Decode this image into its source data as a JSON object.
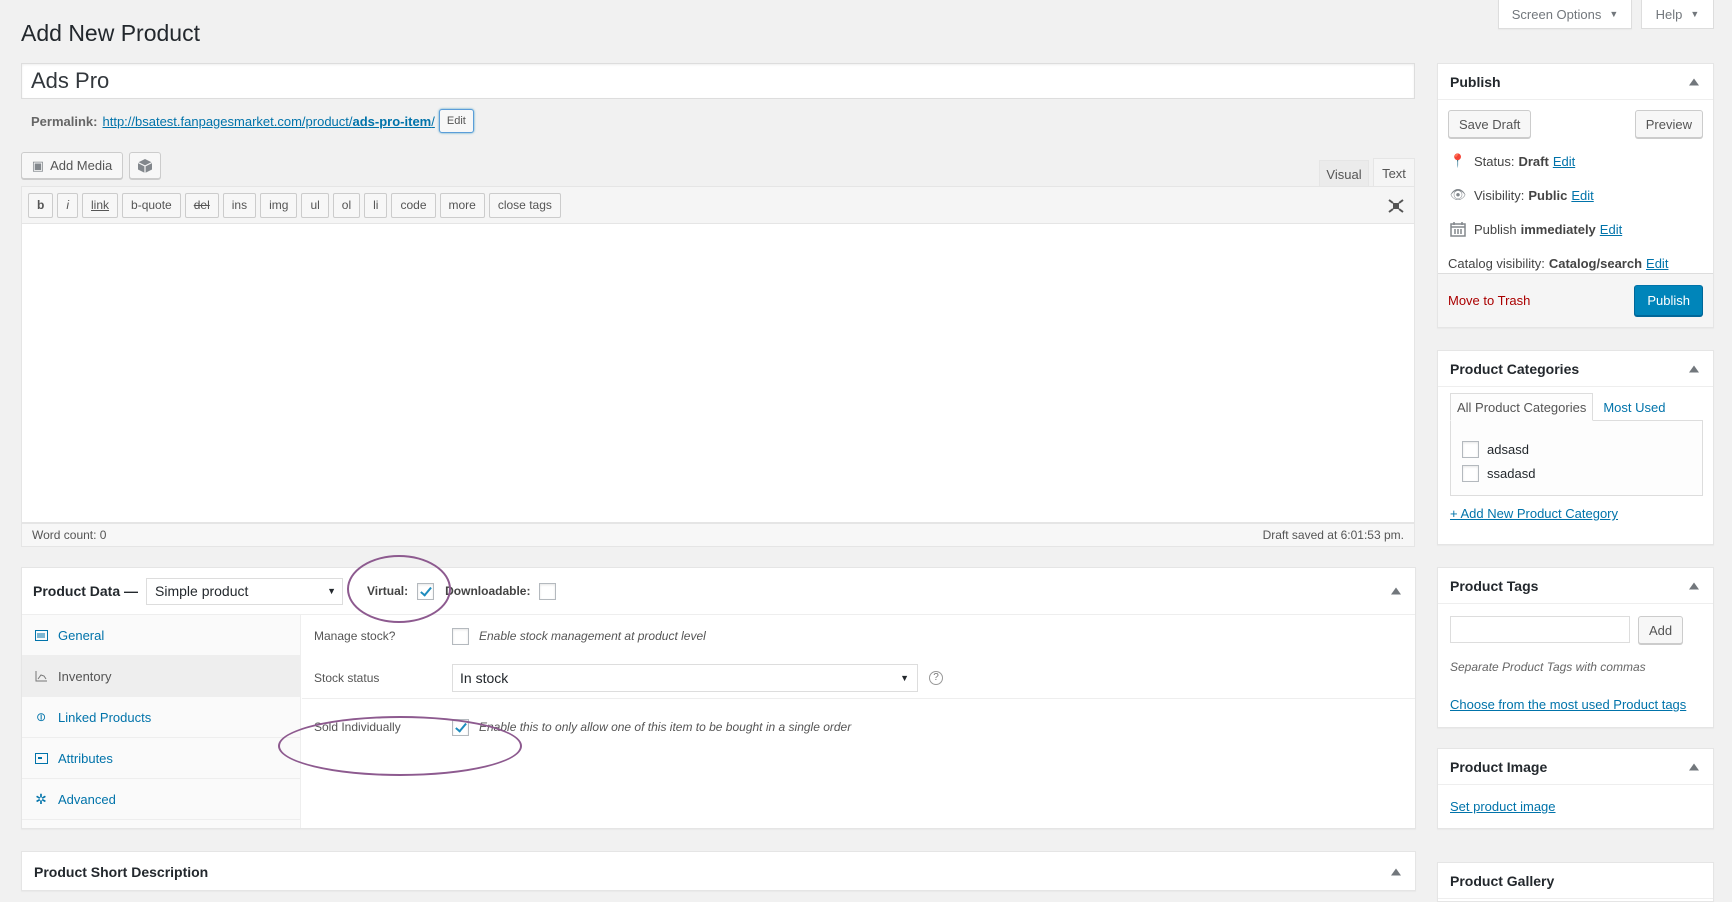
{
  "header": {
    "page_title": "Add New Product",
    "screen_options": "Screen Options",
    "help": "Help"
  },
  "title_input": {
    "value": "Ads Pro"
  },
  "permalink": {
    "label": "Permalink:",
    "url_base": "http://bsatest.fanpagesmarket.com/product/",
    "slug": "ads-pro-item",
    "trailing": "/",
    "edit_label": "Edit"
  },
  "editor": {
    "add_media": "Add Media",
    "tab_visual": "Visual",
    "tab_text": "Text",
    "quicktags": [
      "b",
      "i",
      "link",
      "b-quote",
      "del",
      "ins",
      "img",
      "ul",
      "ol",
      "li",
      "code",
      "more",
      "close tags"
    ],
    "content": "",
    "word_count": "Word count: 0",
    "draft_saved": "Draft saved at 6:01:53 pm."
  },
  "product_data": {
    "title": "Product Data —",
    "type_selected": "Simple product",
    "virtual_label": "Virtual:",
    "virtual_checked": true,
    "downloadable_label": "Downloadable:",
    "downloadable_checked": false,
    "tabs": [
      {
        "label": "General",
        "icon": "general-icon"
      },
      {
        "label": "Inventory",
        "icon": "inventory-icon",
        "active": true
      },
      {
        "label": "Linked Products",
        "icon": "link-icon"
      },
      {
        "label": "Attributes",
        "icon": "attributes-icon"
      },
      {
        "label": "Advanced",
        "icon": "gear-icon"
      }
    ],
    "inventory": {
      "manage_stock_label": "Manage stock?",
      "manage_stock_desc": "Enable stock management at product level",
      "manage_stock_checked": false,
      "stock_status_label": "Stock status",
      "stock_status_value": "In stock",
      "sold_individually_label": "Sold Individually",
      "sold_individually_desc": "Enable this to only allow one of this item to be bought in a single order",
      "sold_individually_checked": true
    }
  },
  "short_description": {
    "title": "Product Short Description"
  },
  "publish": {
    "title": "Publish",
    "save_draft": "Save Draft",
    "preview": "Preview",
    "status_label": "Status:",
    "status_value": "Draft",
    "visibility_label": "Visibility:",
    "visibility_value": "Public",
    "publish_label": "Publish",
    "publish_value": "immediately",
    "catalog_label": "Catalog visibility:",
    "catalog_value": "Catalog/search",
    "edit": "Edit",
    "move_to_trash": "Move to Trash",
    "publish_button": "Publish"
  },
  "categories": {
    "title": "Product Categories",
    "tab_all": "All Product Categories",
    "tab_most_used": "Most Used",
    "items": [
      {
        "label": "adsasd",
        "checked": false
      },
      {
        "label": "ssadasd",
        "checked": false
      }
    ],
    "add_new": "+ Add New Product Category"
  },
  "tags": {
    "title": "Product Tags",
    "input_value": "",
    "add_button": "Add",
    "hint": "Separate Product Tags with commas",
    "choose_link": "Choose from the most used Product tags"
  },
  "product_image": {
    "title": "Product Image",
    "set_link": "Set product image"
  },
  "product_gallery": {
    "title": "Product Gallery"
  },
  "colors": {
    "accent": "#0073aa",
    "publish_button": "#0085ba",
    "trash": "#a00",
    "annotation_circle": "#8d5a8f"
  }
}
